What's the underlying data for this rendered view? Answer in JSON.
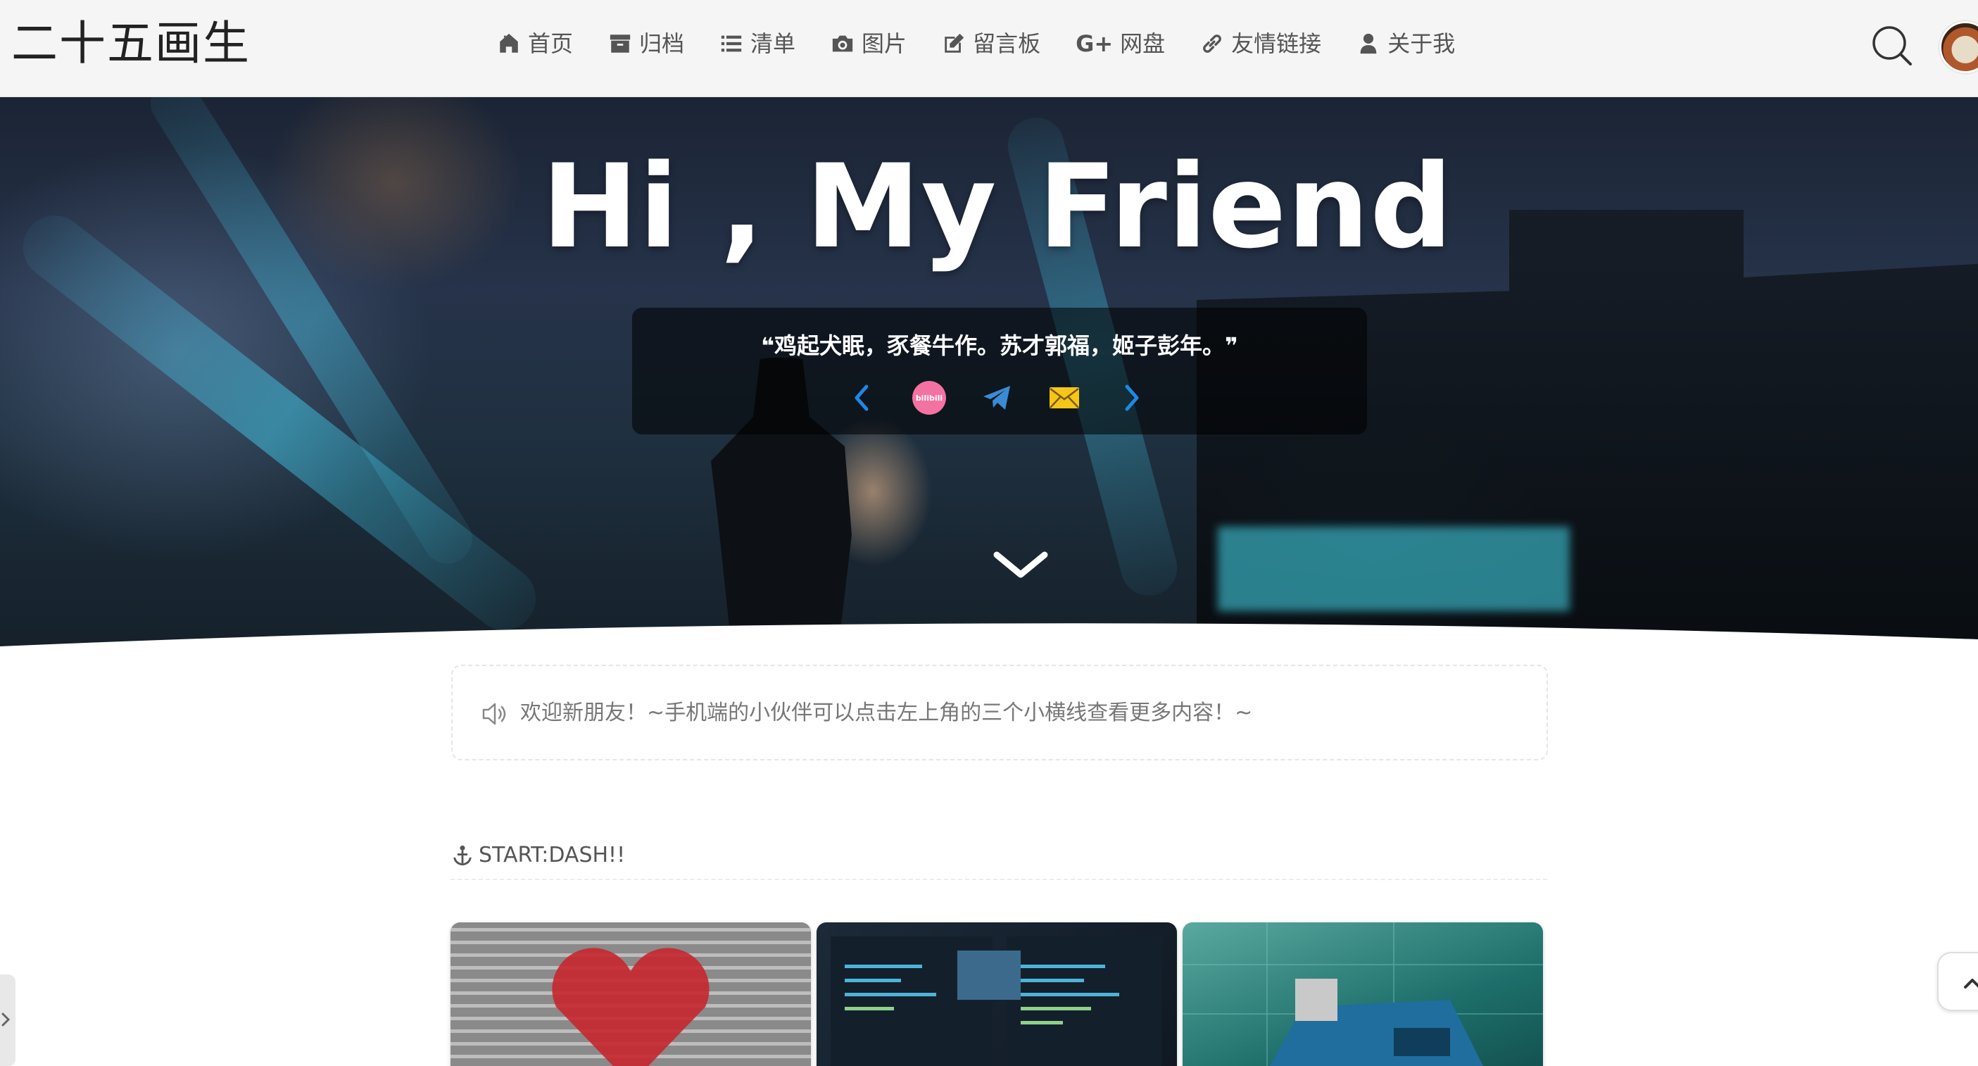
{
  "header": {
    "site_title": "二十五画生",
    "nav": [
      {
        "label": "首页",
        "icon": "home-icon"
      },
      {
        "label": "归档",
        "icon": "archive-icon"
      },
      {
        "label": "清单",
        "icon": "list-icon"
      },
      {
        "label": "图片",
        "icon": "camera-icon"
      },
      {
        "label": "留言板",
        "icon": "edit-icon"
      },
      {
        "label": "网盘",
        "icon": "google-plus-icon"
      },
      {
        "label": "友情链接",
        "icon": "link-icon"
      },
      {
        "label": "关于我",
        "icon": "user-icon"
      }
    ],
    "gplus_glyph": "G+"
  },
  "hero": {
    "title": "Hi , My Friend",
    "quote": "鸡起犬眠，豕餐牛作。苏才郭福，姬子彭年。",
    "social": [
      {
        "icon": "chevron-left-icon",
        "color": "#1e88e5"
      },
      {
        "icon": "bilibili-icon",
        "label": "bilibili",
        "color": "#f472a1"
      },
      {
        "icon": "telegram-icon",
        "color": "#3a8bd4"
      },
      {
        "icon": "mail-icon",
        "color": "#f5c518"
      },
      {
        "icon": "chevron-right-icon",
        "color": "#1e88e5"
      }
    ]
  },
  "notice": {
    "text": "欢迎新朋友！~手机端的小伙伴可以点击左上角的三个小横线查看更多内容！~"
  },
  "section": {
    "title": "START:DASH!!"
  },
  "colors": {
    "header_bg": "#f5f5f5",
    "accent_blue": "#1e88e5",
    "text": "#555555"
  }
}
